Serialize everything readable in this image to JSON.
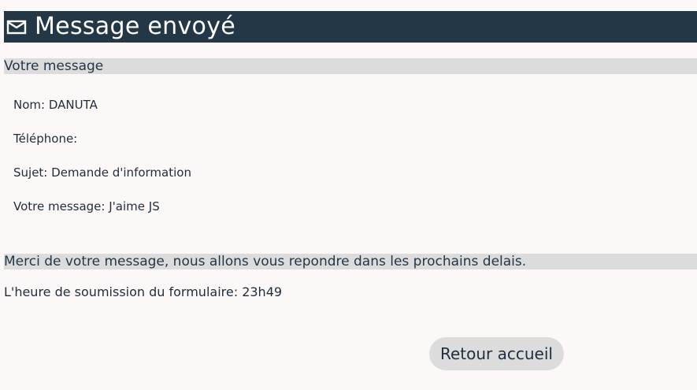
{
  "header": {
    "title": "Message envoyé",
    "icon": "envelope-icon"
  },
  "message_section": {
    "heading": "Votre message",
    "fields": [
      {
        "label": "Nom:",
        "value": "DANUTA"
      },
      {
        "label": "Téléphone:",
        "value": ""
      },
      {
        "label": "Sujet:",
        "value": "Demande d'information"
      },
      {
        "label": "Votre message:",
        "value": "J'aime JS"
      }
    ]
  },
  "confirmation": {
    "text": "Merci de votre message, nous allons vous repondre dans les prochains delais.",
    "submit_time_label": "L'heure de soumission du formulaire:",
    "submit_time_value": "23h49"
  },
  "actions": {
    "home_button_label": "Retour accueil"
  },
  "colors": {
    "header_bg": "#243746",
    "section_bg": "#dcdcdc",
    "page_bg": "#fcf8f7"
  }
}
